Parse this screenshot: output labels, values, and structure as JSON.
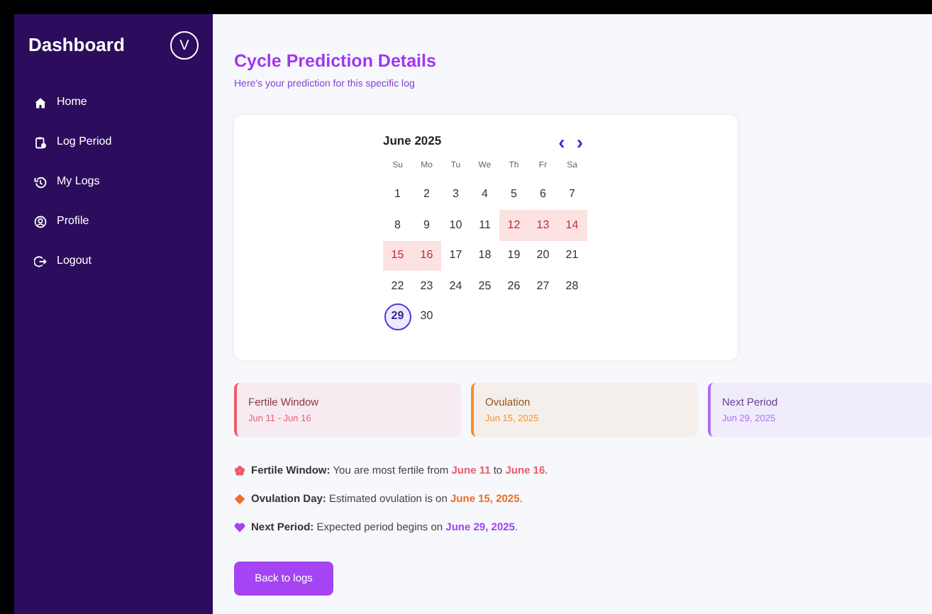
{
  "sidebar": {
    "title": "Dashboard",
    "avatar": "V",
    "items": [
      {
        "label": "Home",
        "selected": false
      },
      {
        "label": "Log Period",
        "selected": false
      },
      {
        "label": "My Logs",
        "selected": false
      },
      {
        "label": "Profile",
        "selected": false
      },
      {
        "label": "Logout",
        "selected": false
      }
    ]
  },
  "header": {
    "title": "Cycle Prediction Details",
    "subtitle": "Here's your prediction for this specific log"
  },
  "calendar": {
    "month": "June 2025",
    "prev": "‹",
    "next": "›",
    "weekdays": [
      "Su",
      "Mo",
      "Tu",
      "We",
      "Th",
      "Fr",
      "Sa"
    ],
    "days": [
      {
        "label": "1",
        "fertile": false,
        "selected": false
      },
      {
        "label": "2",
        "fertile": false,
        "selected": false
      },
      {
        "label": "3",
        "fertile": false,
        "selected": false
      },
      {
        "label": "4",
        "fertile": false,
        "selected": false
      },
      {
        "label": "5",
        "fertile": false,
        "selected": false
      },
      {
        "label": "6",
        "fertile": false,
        "selected": false
      },
      {
        "label": "7",
        "fertile": false,
        "selected": false
      },
      {
        "label": "8",
        "fertile": false,
        "selected": false
      },
      {
        "label": "9",
        "fertile": false,
        "selected": false
      },
      {
        "label": "10",
        "fertile": false,
        "selected": false
      },
      {
        "label": "11",
        "fertile": false,
        "selected": false
      },
      {
        "label": "12",
        "fertile": true,
        "selected": false
      },
      {
        "label": "13",
        "fertile": true,
        "selected": false
      },
      {
        "label": "14",
        "fertile": true,
        "selected": false
      },
      {
        "label": "15",
        "fertile": true,
        "selected": false
      },
      {
        "label": "16",
        "fertile": true,
        "selected": false
      },
      {
        "label": "17",
        "fertile": false,
        "selected": false
      },
      {
        "label": "18",
        "fertile": false,
        "selected": false
      },
      {
        "label": "19",
        "fertile": false,
        "selected": false
      },
      {
        "label": "20",
        "fertile": false,
        "selected": false
      },
      {
        "label": "21",
        "fertile": false,
        "selected": false
      },
      {
        "label": "22",
        "fertile": false,
        "selected": false
      },
      {
        "label": "23",
        "fertile": false,
        "selected": false
      },
      {
        "label": "24",
        "fertile": false,
        "selected": false
      },
      {
        "label": "25",
        "fertile": false,
        "selected": false
      },
      {
        "label": "26",
        "fertile": false,
        "selected": false
      },
      {
        "label": "27",
        "fertile": false,
        "selected": false
      },
      {
        "label": "28",
        "fertile": false,
        "selected": false
      },
      {
        "label": "29",
        "fertile": false,
        "selected": true
      },
      {
        "label": "30",
        "fertile": false,
        "selected": false
      }
    ]
  },
  "summary_cards": [
    {
      "title": "Fertile Window",
      "value": "Jun 11 - Jun 16",
      "color": "#ef5b6b"
    },
    {
      "title": "Ovulation",
      "value": "Jun 15, 2025",
      "color": "#f5902a"
    },
    {
      "title": "Next Period",
      "value": "Jun 29, 2025",
      "color": "#b06cf5"
    }
  ],
  "notes": [
    {
      "color": "#ef5b6b",
      "label": "Fertile Window:",
      "parts": [
        {
          "text": " You are most fertile from ",
          "em": false
        },
        {
          "text": "June 11",
          "em": true
        },
        {
          "text": " to ",
          "em": false
        },
        {
          "text": "June 16",
          "em": true
        },
        {
          "text": ".",
          "em": false
        }
      ]
    },
    {
      "color": "#f26b2a",
      "label": "Ovulation Day:",
      "parts": [
        {
          "text": " Estimated ovulation is on ",
          "em": false
        },
        {
          "text": "June 15, 2025",
          "em": true
        },
        {
          "text": ".",
          "em": false
        }
      ]
    },
    {
      "color": "#a445f5",
      "label": "Next Period:",
      "parts": [
        {
          "text": " Expected period begins on ",
          "em": false
        },
        {
          "text": "June 29, 2025",
          "em": true
        },
        {
          "text": ".",
          "em": false
        }
      ]
    }
  ],
  "back_button": "Back to logs"
}
